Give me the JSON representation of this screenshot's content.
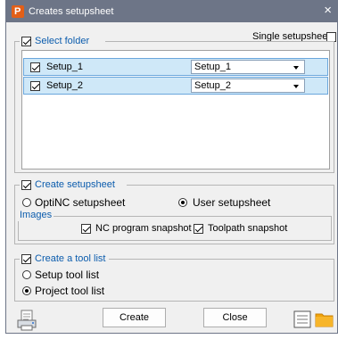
{
  "window": {
    "title": "Creates setupsheet",
    "app_icon_letter": "P",
    "close_glyph": "×"
  },
  "single_setupsheet": {
    "label": "Single setupsheet",
    "checked": false
  },
  "select_folder": {
    "label": "Select folder",
    "checked": true,
    "rows": [
      {
        "name": "Setup_1",
        "checked": true,
        "selected_value": "Setup_1"
      },
      {
        "name": "Setup_2",
        "checked": true,
        "selected_value": "Setup_2"
      }
    ]
  },
  "create_setupsheet": {
    "label": "Create setupsheet",
    "checked": true,
    "options": [
      {
        "label": "OptiNC setupsheet",
        "selected": false
      },
      {
        "label": "User setupsheet",
        "selected": true
      }
    ],
    "images": {
      "label": "Images",
      "nc_program_snapshot": {
        "label": "NC program snapshot",
        "checked": true
      },
      "toolpath_snapshot": {
        "label": "Toolpath snapshot",
        "checked": true
      }
    }
  },
  "tool_list": {
    "label": "Create a tool list",
    "checked": true,
    "options": [
      {
        "label": "Setup tool list",
        "selected": false
      },
      {
        "label": "Project tool list",
        "selected": true
      }
    ]
  },
  "footer": {
    "create_label": "Create",
    "close_label": "Close",
    "icons": [
      "printer-document-icon",
      "list-view-icon",
      "folder-icon"
    ],
    "colors": {
      "folder": "#f0a30a",
      "accent_blue": "#0b5cad",
      "titlebar": "#6d7587",
      "row_selected": "#cfe8f8"
    }
  }
}
